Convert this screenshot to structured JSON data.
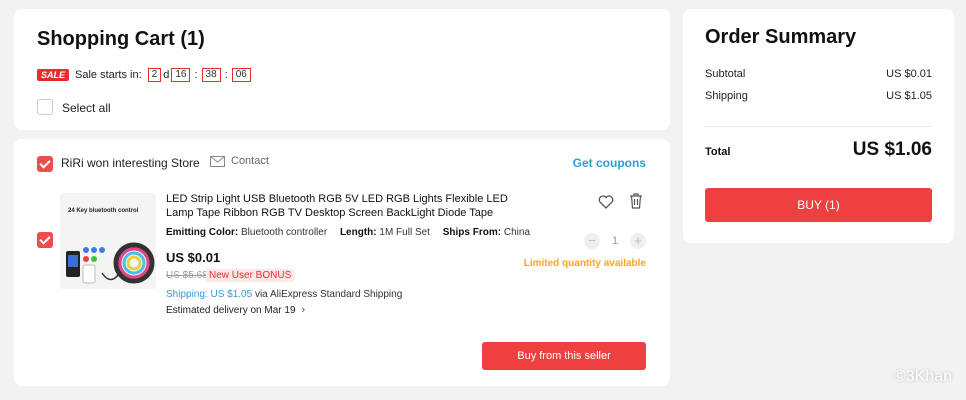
{
  "cart": {
    "title": "Shopping Cart (1)",
    "sale_tag": "SALE",
    "sale_label": "Sale starts in:",
    "countdown": {
      "days": "2",
      "day_unit": "d",
      "hours": "16",
      "minutes": "38",
      "seconds": "06",
      "sep": ":"
    },
    "select_all": "Select all"
  },
  "store": {
    "name": "RiRi won interesting Store",
    "contact": "Contact",
    "coupons": "Get coupons",
    "checked": true
  },
  "item": {
    "thumb_text": "24 Key bluetooth control",
    "title": "LED Strip Light USB Bluetooth RGB 5V LED RGB Lights Flexible LED Lamp Tape Ribbon RGB TV Desktop Screen BackLight Diode Tape",
    "props": [
      {
        "key": "Emitting Color:",
        "value": "Bluetooth controller"
      },
      {
        "key": "Length:",
        "value": "1M Full Set"
      },
      {
        "key": "Ships From:",
        "value": "China"
      }
    ],
    "price": "US $0.01",
    "original_price": "US $5.68",
    "bonus": "New User BONUS",
    "shipping_price": "Shipping: US $1.05",
    "shipping_method": "via AliExpress Standard Shipping",
    "delivery": "Estimated delivery on Mar 19",
    "quantity": "1",
    "limited": "Limited quantity available",
    "buy_from_seller": "Buy from this seller",
    "icons": [
      "wishlist-heart-icon",
      "trash-icon",
      "minus-icon",
      "plus-icon",
      "chevron-right-icon",
      "mail-icon"
    ]
  },
  "summary": {
    "title": "Order Summary",
    "rows": [
      {
        "label": "Subtotal",
        "value": "US $0.01"
      },
      {
        "label": "Shipping",
        "value": "US $1.05"
      }
    ],
    "total_label": "Total",
    "total_value": "US $1.06",
    "buy": "BUY (1)"
  },
  "watermark": "©3Khan",
  "colors": {
    "accent_red": "#ee4040",
    "link_blue": "#2a9fd8",
    "warning_orange": "#f5a623"
  }
}
